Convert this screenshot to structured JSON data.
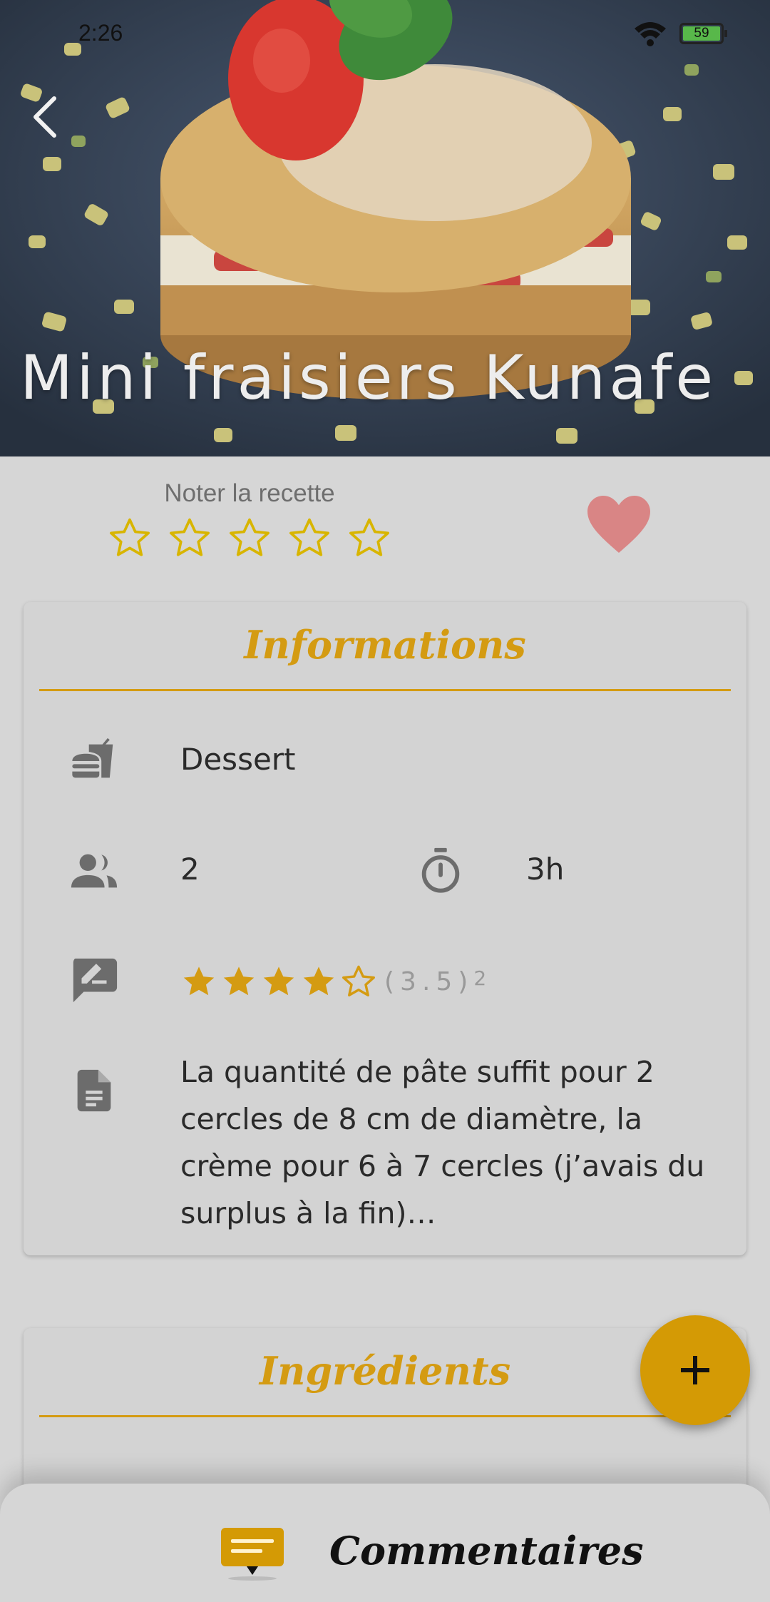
{
  "status_bar": {
    "time": "2:26",
    "battery": "59",
    "battery_level": 0.59
  },
  "recipe": {
    "title": "Mini fraisiers Kunafe"
  },
  "rating_prompt": {
    "label": "Noter la recette",
    "stars": 5
  },
  "info": {
    "heading": "Informations",
    "category": "Dessert",
    "servings": "2",
    "duration": "3h",
    "rating": {
      "stars_value": 3.5,
      "score": "(3.5)",
      "count": "2"
    },
    "description": "La quantité de pâte suffit pour 2 cercles de 8 cm de diamètre, la crème pour 6 à 7 cercles (j’avais du surplus à la fin)…"
  },
  "ingredients": {
    "heading": "Ingrédients"
  },
  "comments": {
    "label": "Commentaires"
  },
  "colors": {
    "accent": "#d49b12",
    "fab": "#d49a05",
    "heart": "#d98585",
    "star_outline": "#d8b500"
  }
}
